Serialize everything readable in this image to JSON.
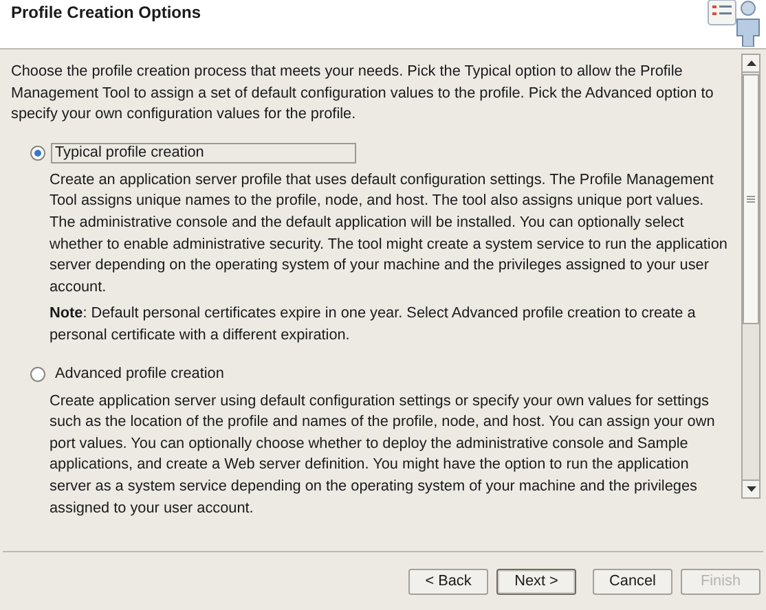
{
  "header": {
    "title": "Profile Creation Options"
  },
  "intro": "Choose the profile creation process that meets your needs. Pick the Typical option to allow the Profile Management Tool to assign a set of default configuration values to the profile. Pick the Advanced option to specify your own configuration values for the profile.",
  "options": [
    {
      "label": "Typical profile creation",
      "selected": true,
      "focused": true,
      "description": "Create an application server profile that uses default configuration settings. The Profile Management Tool assigns unique names to the profile, node, and host. The tool also assigns unique port values. The administrative console and the default application will be installed. You can optionally select whether to enable administrative security. The tool might create a system service to run the application server depending on the operating system of your machine and the privileges assigned to your user account.",
      "note": "**Note**: Default personal certificates expire in one year.  Select Advanced profile creation to create a personal certificate with a different expiration."
    },
    {
      "label": "Advanced profile creation",
      "selected": false,
      "focused": false,
      "description": "Create application server using default configuration settings or specify your own values for settings such as the location of the profile and names of the profile, node, and host. You can assign your own port values. You can optionally choose whether to deploy the administrative console and Sample applications, and create a Web server definition. You might have the option to run the application server as a system service depending on the operating system of your machine and the privileges assigned to your user account."
    }
  ],
  "buttons": [
    {
      "label": "< Back",
      "disabled": false,
      "default": false
    },
    {
      "label": "Next >",
      "disabled": false,
      "default": true
    },
    {
      "label": "Cancel",
      "disabled": false,
      "default": false
    },
    {
      "label": "Finish",
      "disabled": true,
      "default": false
    }
  ]
}
